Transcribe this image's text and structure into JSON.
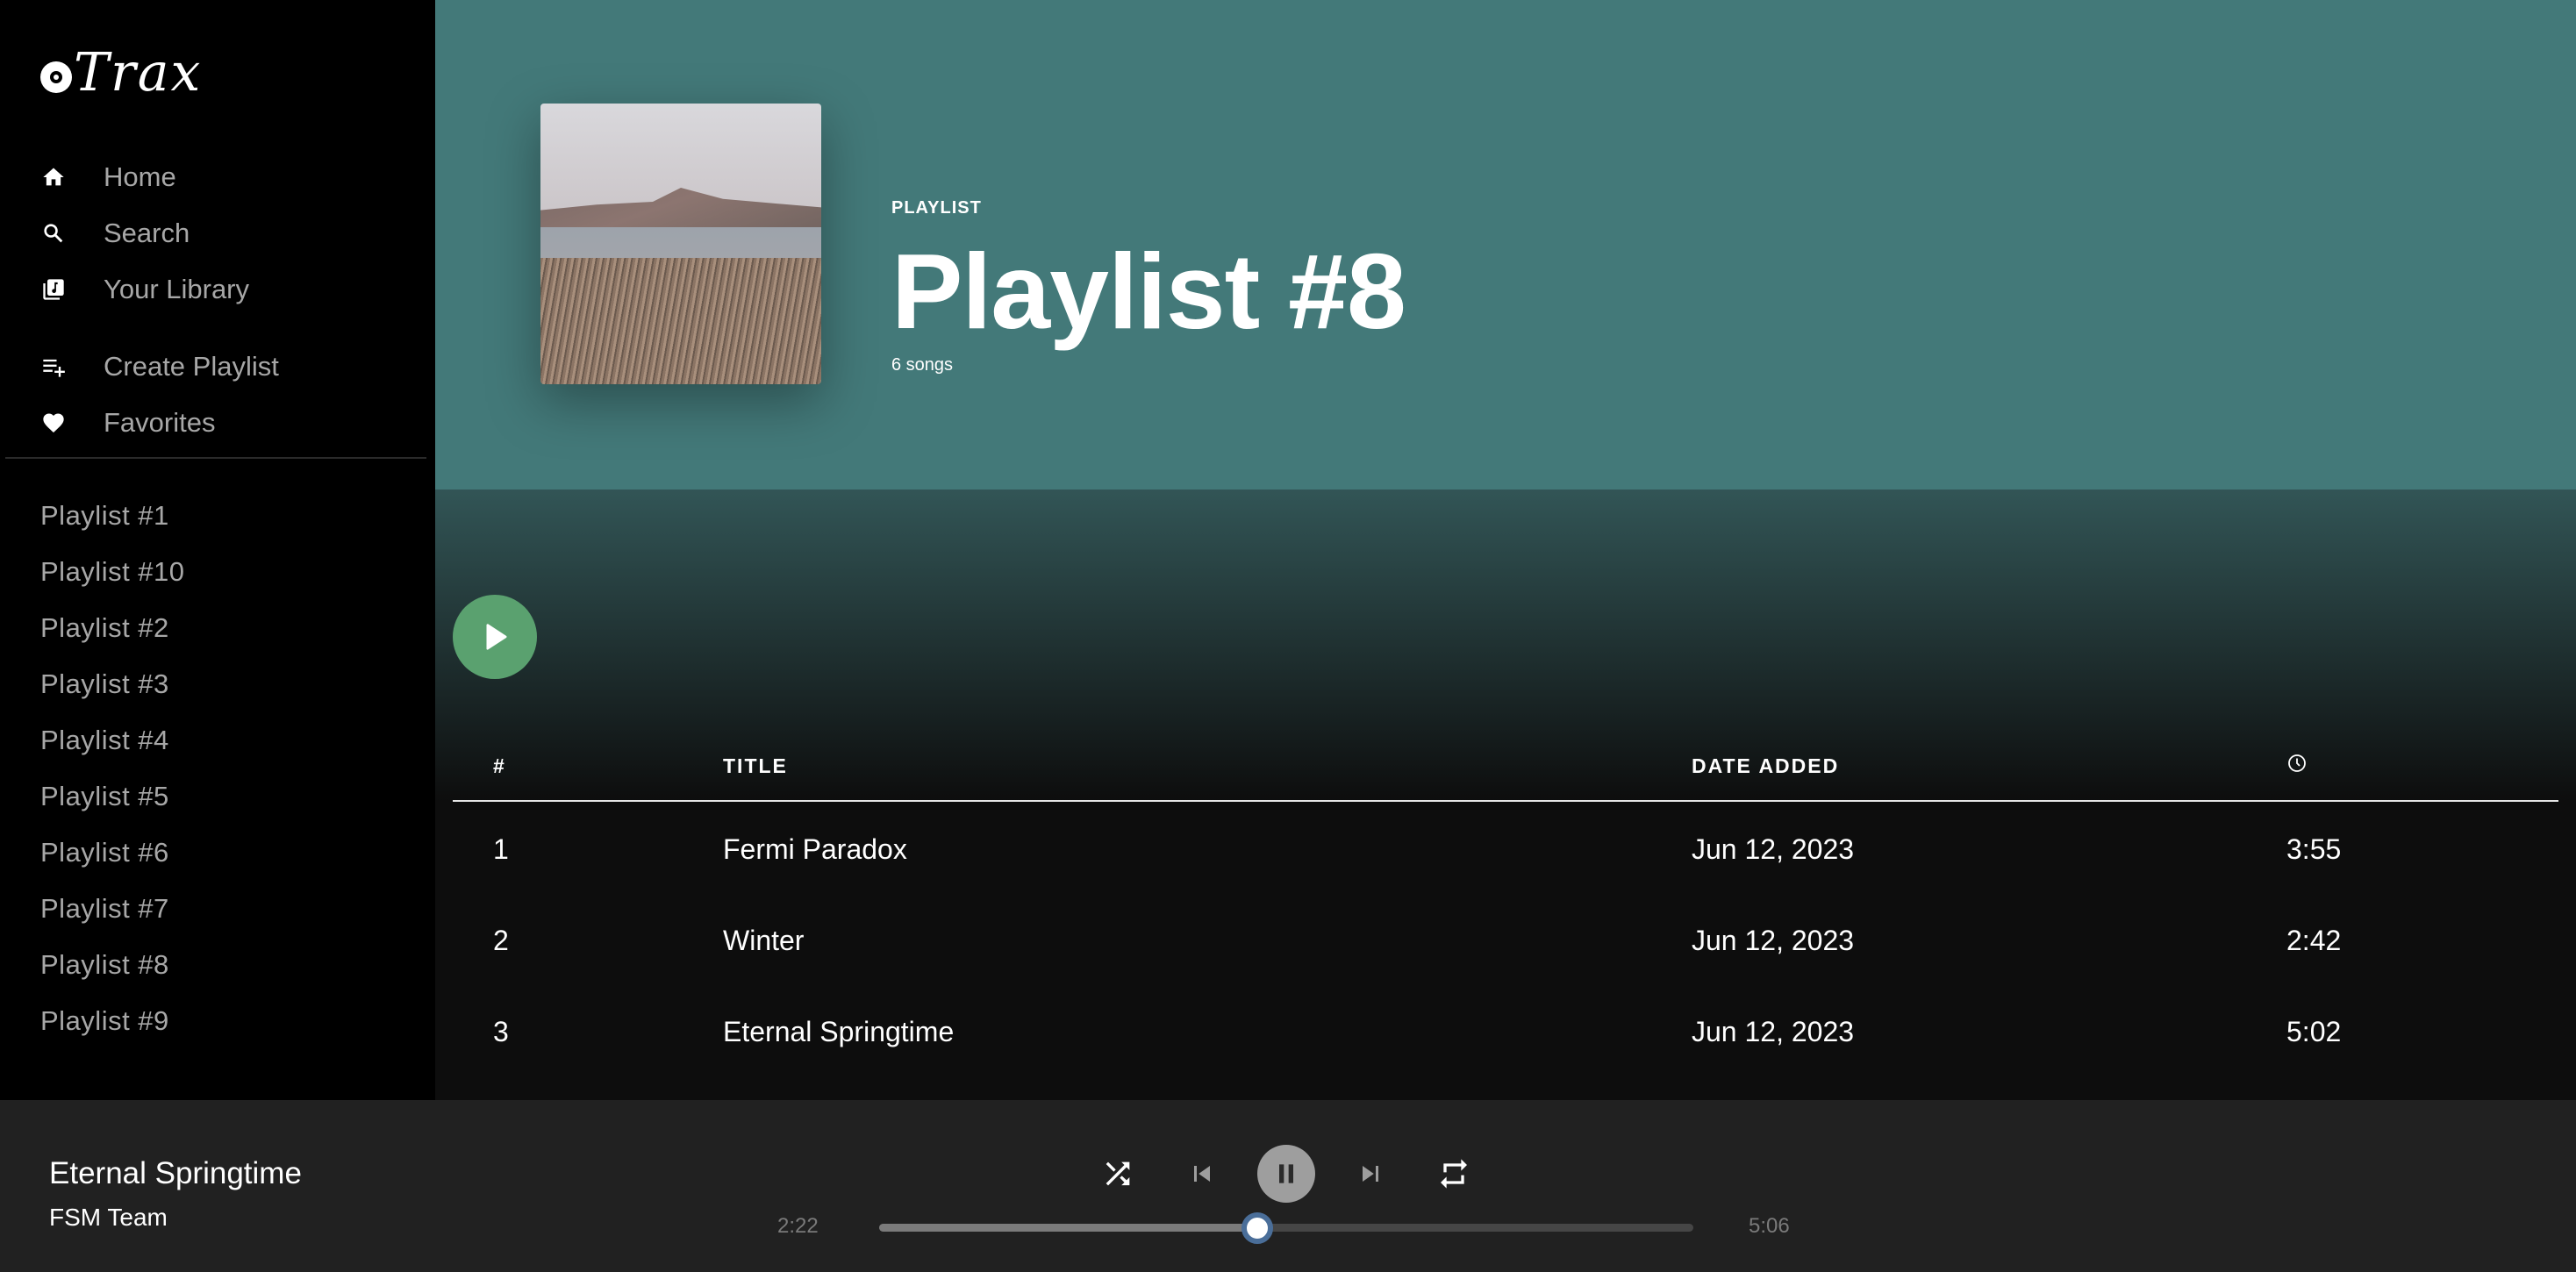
{
  "app": {
    "name": "Trax"
  },
  "sidebar": {
    "nav": [
      {
        "label": "Home",
        "icon": "home-icon"
      },
      {
        "label": "Search",
        "icon": "search-icon"
      },
      {
        "label": "Your Library",
        "icon": "library-icon"
      }
    ],
    "actions": [
      {
        "label": "Create Playlist",
        "icon": "playlist-add-icon"
      },
      {
        "label": "Favorites",
        "icon": "heart-icon"
      }
    ],
    "playlists": [
      "Playlist #1",
      "Playlist #10",
      "Playlist #2",
      "Playlist #3",
      "Playlist #4",
      "Playlist #5",
      "Playlist #6",
      "Playlist #7",
      "Playlist #8",
      "Playlist #9"
    ]
  },
  "hero": {
    "type_label": "PLAYLIST",
    "title": "Playlist #8",
    "song_count": "6 songs",
    "bg_color": "#437979"
  },
  "table": {
    "headers": {
      "num": "#",
      "title": "TITLE",
      "date": "DATE ADDED",
      "duration_icon": "clock-icon"
    },
    "rows": [
      {
        "num": "1",
        "title": "Fermi Paradox",
        "date": "Jun 12, 2023",
        "duration": "3:55"
      },
      {
        "num": "2",
        "title": "Winter",
        "date": "Jun 12, 2023",
        "duration": "2:42"
      },
      {
        "num": "3",
        "title": "Eternal Springtime",
        "date": "Jun 12, 2023",
        "duration": "5:02"
      }
    ]
  },
  "player": {
    "title": "Eternal Springtime",
    "artist": "FSM Team",
    "elapsed": "2:22",
    "total": "5:06",
    "progress": 0.464,
    "state": "playing",
    "accent_color": "#5aa16f"
  }
}
